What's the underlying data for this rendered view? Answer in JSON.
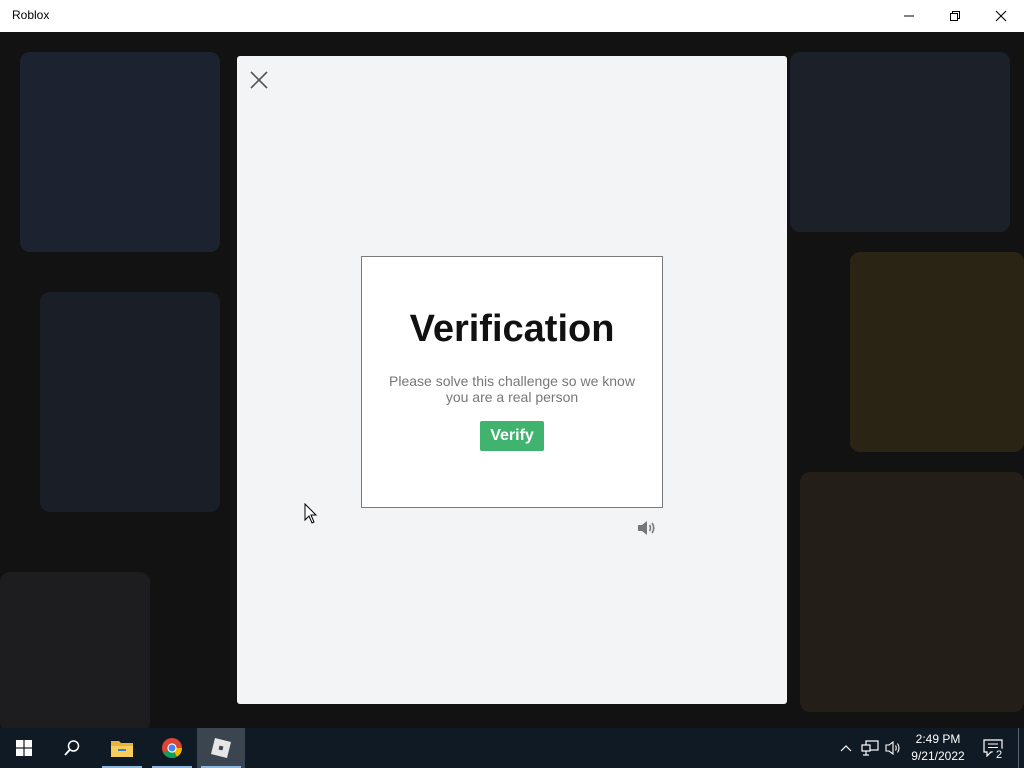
{
  "window": {
    "title": "Roblox"
  },
  "modal": {
    "challenge": {
      "title": "Verification",
      "description": "Please solve this challenge so we know you are a real person",
      "verify_label": "Verify"
    }
  },
  "icons": {
    "close": "close-icon",
    "audio": "speaker-icon",
    "minimize": "minimize-icon",
    "restore": "restore-icon"
  },
  "colors": {
    "verify_button": "#40b36e",
    "modal_bg": "#f2f4f5",
    "taskbar_bg": "#101a24"
  },
  "taskbar": {
    "time": "2:49 PM",
    "date": "9/21/2022",
    "notification_count": "2"
  }
}
